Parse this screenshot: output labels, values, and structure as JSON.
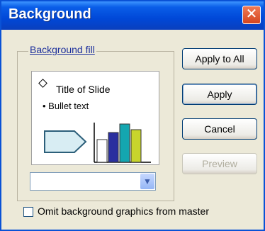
{
  "dialog": {
    "title": "Background",
    "close_symbol": "✕"
  },
  "fill": {
    "label": "Background fill",
    "preview": {
      "title": "Title of Slide",
      "bullet": "• Bullet text"
    },
    "color_select_value": ""
  },
  "buttons": {
    "apply_to_all": "Apply to All",
    "apply": "Apply",
    "cancel": "Cancel",
    "preview": "Preview"
  },
  "option": {
    "omit_label": "Omit background graphics from master",
    "checked": false
  },
  "icons": {
    "close": "close-icon",
    "combo_arrow": "chevron-down-icon",
    "preview_diamond": "diamond-bullet-icon"
  }
}
